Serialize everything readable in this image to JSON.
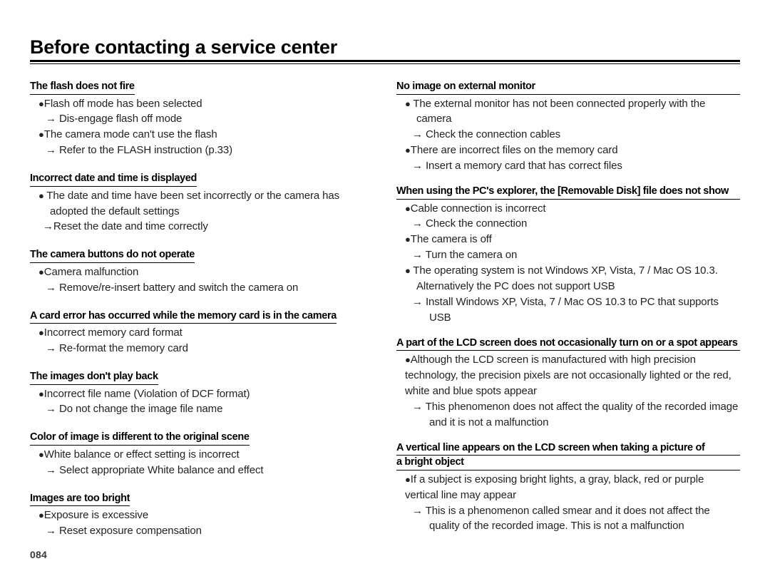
{
  "document": {
    "title": "Before contacting a service center",
    "page_number": "084",
    "bullet_glyph": "●",
    "arrow_glyph": "→"
  },
  "left_column": [
    {
      "heading": "The flash does not fire",
      "items": [
        {
          "type": "bullet",
          "text": "Flash off mode has been selected"
        },
        {
          "type": "arrow",
          "text": "Dis-engage flash off mode"
        },
        {
          "type": "bullet",
          "text": "The camera mode can't use the flash"
        },
        {
          "type": "arrow",
          "text": "Refer to the FLASH instruction (p.33)"
        }
      ]
    },
    {
      "heading": "Incorrect date and time is displayed",
      "items": [
        {
          "type": "bullet-wrap",
          "text": "The date and time have been set incorrectly or the camera has adopted the default settings"
        },
        {
          "type": "arrow-tight",
          "text": "Reset the date and time correctly"
        }
      ]
    },
    {
      "heading": "The camera buttons do not operate",
      "items": [
        {
          "type": "bullet",
          "text": "Camera malfunction"
        },
        {
          "type": "arrow",
          "text": "Remove/re-insert battery and switch the camera on"
        }
      ]
    },
    {
      "heading": "A card error has occurred while the memory card is in the camera",
      "items": [
        {
          "type": "bullet",
          "text": "Incorrect memory card format"
        },
        {
          "type": "arrow",
          "text": "Re-format the memory card"
        }
      ]
    },
    {
      "heading": "The images don't play back",
      "items": [
        {
          "type": "bullet",
          "text": "Incorrect file name (Violation of DCF format)"
        },
        {
          "type": "arrow",
          "text": "Do not change the image file name"
        }
      ]
    },
    {
      "heading": "Color of image is different to the original scene",
      "items": [
        {
          "type": "bullet",
          "text": "White balance or effect setting is incorrect"
        },
        {
          "type": "arrow",
          "text": "Select appropriate White balance and effect"
        }
      ]
    },
    {
      "heading": "Images are too bright",
      "items": [
        {
          "type": "bullet",
          "text": "Exposure is excessive"
        },
        {
          "type": "arrow",
          "text": "Reset exposure compensation"
        }
      ]
    }
  ],
  "right_column": [
    {
      "heading": "No image on external monitor",
      "heading_lines": [
        "No image on external monitor"
      ],
      "items": [
        {
          "type": "bullet-wrap",
          "text": "The external monitor has not been connected properly with the camera"
        },
        {
          "type": "arrow",
          "text": "Check the connection cables"
        },
        {
          "type": "bullet",
          "text": "There are incorrect files on the memory card"
        },
        {
          "type": "arrow",
          "text": "Insert a memory card that has correct files"
        }
      ]
    },
    {
      "heading": "When using the PC's explorer, the [Removable Disk] file does not show",
      "heading_lines": [
        "When using the PC's explorer, the [Removable Disk] file does not show"
      ],
      "items": [
        {
          "type": "bullet",
          "text": "Cable connection is incorrect"
        },
        {
          "type": "arrow",
          "text": "Check the connection"
        },
        {
          "type": "bullet",
          "text": "The camera is off"
        },
        {
          "type": "arrow",
          "text": "Turn the camera on"
        },
        {
          "type": "bullet-wrap",
          "text": "The operating system is not Windows XP, Vista, 7 / Mac OS 10.3. Alternatively the PC does not support USB"
        },
        {
          "type": "arrow",
          "text": "Install Windows XP, Vista, 7 / Mac OS 10.3 to PC that supports USB"
        }
      ]
    },
    {
      "heading": "A part of the LCD screen does not occasionally turn on or a spot appears",
      "heading_lines": [
        "A part of the LCD screen does not occasionally turn on or a spot appears"
      ],
      "items": [
        {
          "type": "bullet-wrap-tight",
          "text": "Although the LCD screen is manufactured with high precision technology, the precision pixels are not occasionally lighted or the red, white and blue spots appear"
        },
        {
          "type": "arrow",
          "text": "This phenomenon does not affect the quality of the recorded image and it is not a malfunction"
        }
      ]
    },
    {
      "heading": "A vertical line appears on the LCD screen when taking a picture of a bright object",
      "heading_lines": [
        "A vertical line appears on the LCD screen when taking a picture of",
        "a bright object"
      ],
      "items": [
        {
          "type": "bullet-wrap-tight",
          "text": "If a subject is exposing bright lights, a gray, black, red or purple vertical line may appear"
        },
        {
          "type": "arrow",
          "text": "This is a phenomenon called smear and it does not affect the quality of the recorded image. This is not a malfunction"
        }
      ]
    }
  ]
}
